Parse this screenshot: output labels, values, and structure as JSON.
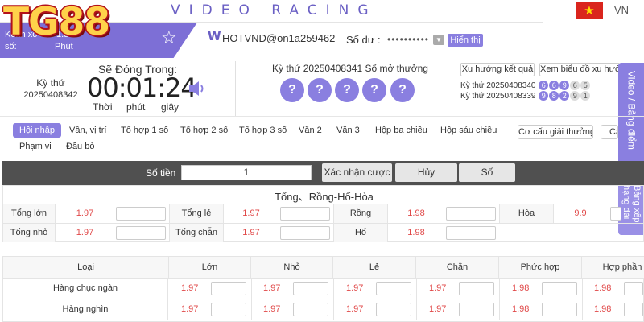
{
  "header": {
    "brand_text": "VIDEO RACING",
    "language_code": "VN",
    "flag_star": "★",
    "logo_text": "TG88"
  },
  "game": {
    "name": "Kênh xổ",
    "name_suffix": "1.5",
    "subtitle": "số:",
    "minute_label": "Phút"
  },
  "account": {
    "w_icon": "W",
    "username": "HOTVND@on1a259462",
    "balance_label": "Số dư :",
    "balance_masked": "••••••••••",
    "show_label": "Hiển thị"
  },
  "draw": {
    "period_label": "Kỳ thứ",
    "period_no": "20250408342",
    "countdown_title": "Sẽ Đóng Trong:",
    "timer": "00:01:24",
    "unit_hours": "Thời",
    "unit_minutes": "phút",
    "unit_seconds": "giây",
    "current_label": "Kỳ thứ 20250408341   Số mở thưởng",
    "balls": [
      "?",
      "?",
      "?",
      "?",
      "?"
    ]
  },
  "trend": {
    "result_trend_label": "Xu hướng kết quả",
    "view_chart_label": "Xem biểu đồ xu hướng",
    "history": [
      {
        "label": "Kỳ thứ 20250408340",
        "nums": [
          "6",
          "6",
          "9",
          "6",
          "5"
        ]
      },
      {
        "label": "Kỳ thứ 20250408339",
        "nums": [
          "9",
          "8",
          "2",
          "9",
          "1"
        ]
      }
    ]
  },
  "side_tabs": {
    "video": "Video / Bảng điểm",
    "ranking": "Bảng xếp hạng dài"
  },
  "bet_tabs": [
    {
      "label": "Hội nhập"
    },
    {
      "label": "Vân, vị trí"
    },
    {
      "label": "Tổ hợp 1 số"
    },
    {
      "label": "Tổ hợp 2 số"
    },
    {
      "label": "Tổ hợp 3 số"
    },
    {
      "label": "Văn 2"
    },
    {
      "label": "Văn 3"
    },
    {
      "label": "Hộp ba chiều"
    },
    {
      "label": "Hộp sáu chiều"
    },
    {
      "label": "Phạm vi"
    },
    {
      "label": "Đầu bò"
    }
  ],
  "prize_structure_label": "Cơ cấu giải thưởng",
  "prize_structure_more": "Cá",
  "betbar": {
    "amount_label": "Số tiền",
    "amount_value": "1",
    "confirm_label": "Xác nhận cược",
    "cancel_label": "Hủy",
    "number_label": "Số"
  },
  "table1": {
    "title": "Tổng、Rồng-Hổ-Hòa",
    "rows": [
      [
        {
          "label": "Tổng lớn",
          "odds": "1.97"
        },
        {
          "label": "Tổng lẻ",
          "odds": "1.97"
        },
        {
          "label": "Rồng",
          "odds": "1.98"
        },
        {
          "label": "Hòa",
          "odds": "9.9"
        }
      ],
      [
        {
          "label": "Tổng nhỏ",
          "odds": "1.97"
        },
        {
          "label": "Tổng chẵn",
          "odds": "1.97"
        },
        {
          "label": "Hổ",
          "odds": "1.98"
        }
      ]
    ]
  },
  "table2": {
    "headers": [
      "Loại",
      "Lớn",
      "Nhỏ",
      "Lẻ",
      "Chẵn",
      "Phức hợp",
      "Hợp phần"
    ],
    "rows": [
      {
        "label": "Hàng chục ngàn",
        "odds": [
          "1.97",
          "1.97",
          "1.97",
          "1.97",
          "1.98",
          "1.98"
        ]
      },
      {
        "label": "Hàng nghìn",
        "odds": [
          "1.97",
          "1.97",
          "1.97",
          "1.97",
          "1.98",
          "1.98"
        ]
      }
    ]
  },
  "colors": {
    "accent": "#8a7fe0",
    "odds_red": "#e04848",
    "bet_bar": "#505050",
    "logo_gold": "#ffd24a"
  }
}
